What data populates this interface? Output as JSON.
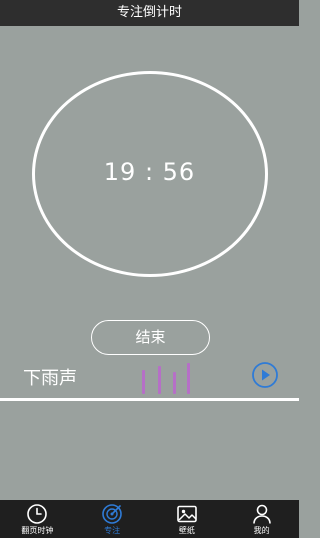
{
  "title_bar": {
    "title": "专注倒计时"
  },
  "timer": {
    "display": "19 : 56"
  },
  "end_button": {
    "label": "结束"
  },
  "sound": {
    "name": "下雨声",
    "icon": "play-icon"
  },
  "nav": {
    "items": [
      {
        "label": "翻页时钟",
        "icon": "clock-icon",
        "active": false
      },
      {
        "label": "专注",
        "icon": "target-icon",
        "active": true
      },
      {
        "label": "壁纸",
        "icon": "image-icon",
        "active": false
      },
      {
        "label": "我的",
        "icon": "person-icon",
        "active": false
      }
    ]
  },
  "colors": {
    "background": "#9aa19e",
    "title_bar": "#2e2e2e",
    "nav_bar": "#1f1f1f",
    "accent_blue": "#2f7bd6",
    "visualizer_bars": "#b66fc7"
  }
}
